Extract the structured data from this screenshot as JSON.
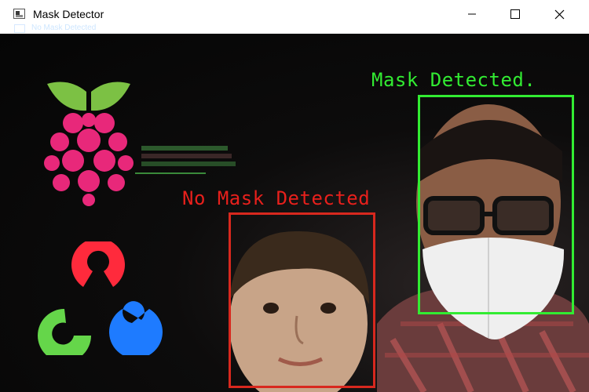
{
  "window": {
    "title": "Mask Detector",
    "ghost_text": "No Mask Detected",
    "controls": {
      "minimize_icon": "minimize-icon",
      "maximize_icon": "maximize-icon",
      "close_icon": "close-icon"
    }
  },
  "detections": [
    {
      "label": "Mask Detected.",
      "color": "#32ec32"
    },
    {
      "label": "No Mask Detected",
      "color": "#e8201c"
    }
  ],
  "logos": {
    "raspberry": "raspberry-pi-logo",
    "opencv": "opencv-logo"
  }
}
